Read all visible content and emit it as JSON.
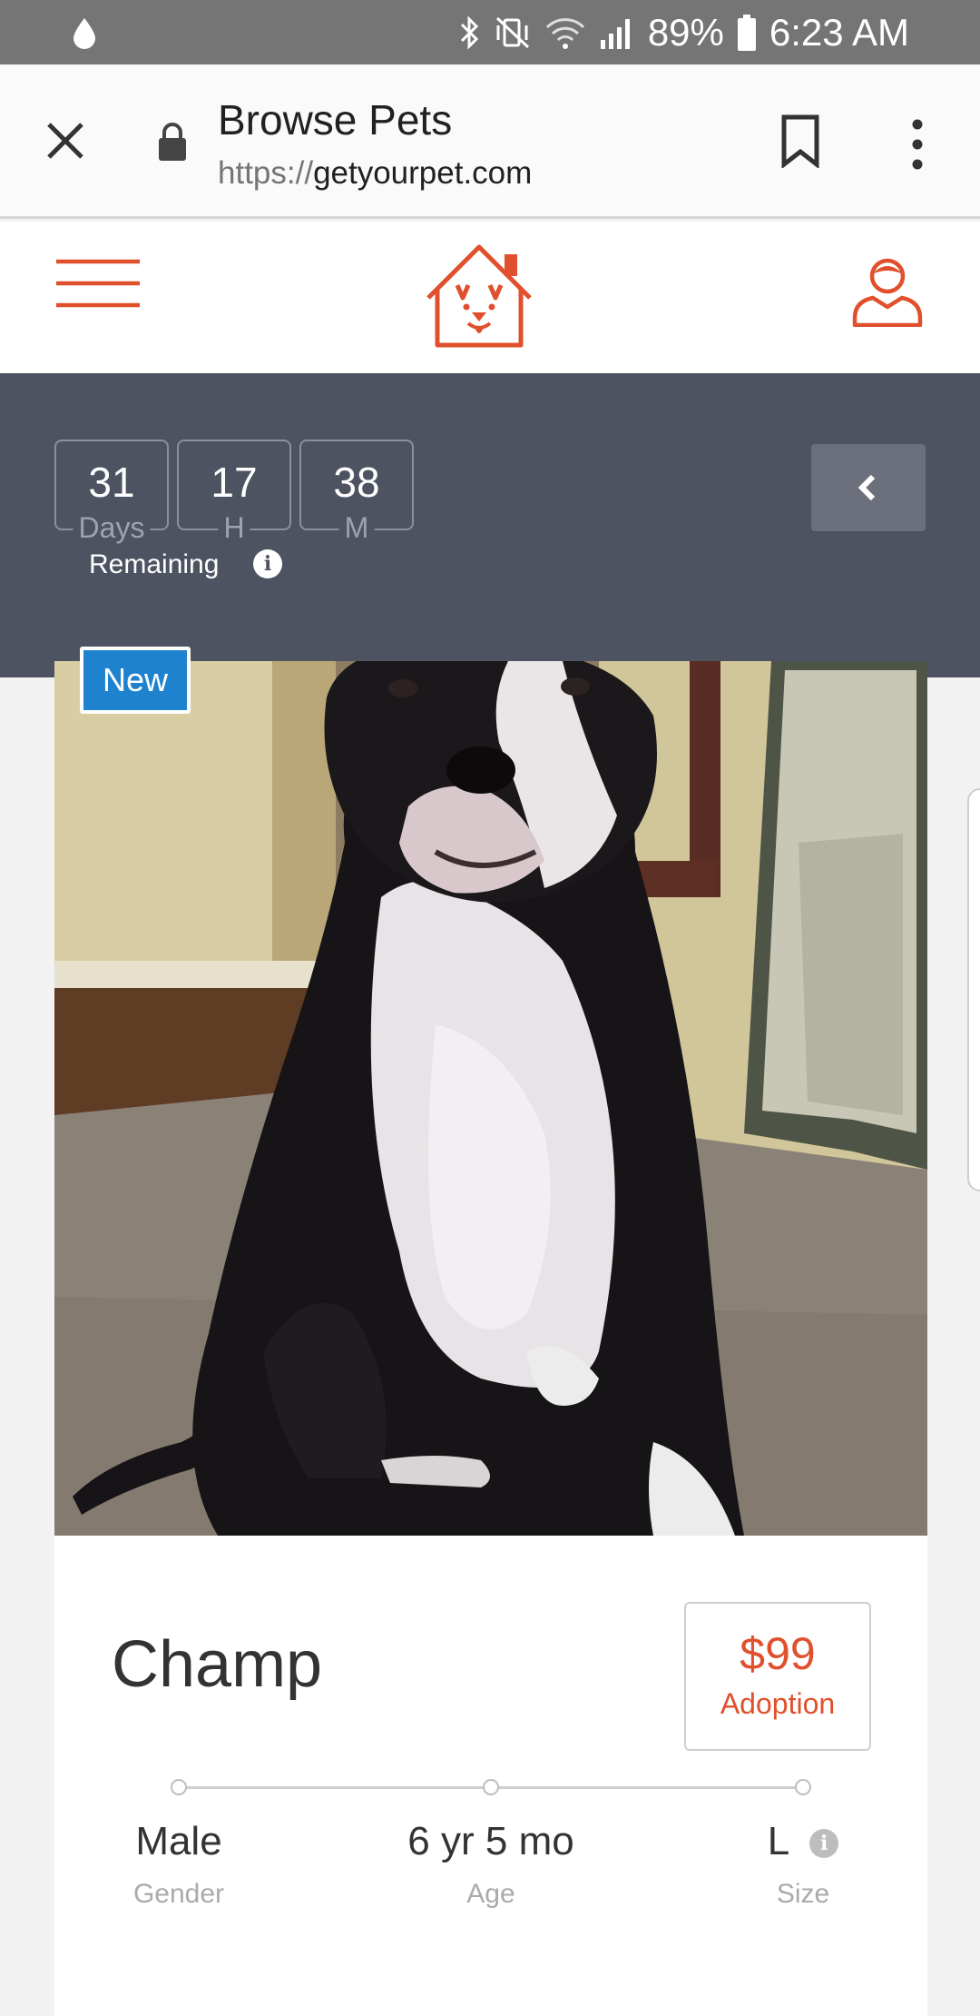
{
  "status_bar": {
    "battery": "89%",
    "time": "6:23 AM"
  },
  "browser": {
    "title": "Browse Pets",
    "url_scheme": "https://",
    "url_host": "getyourpet.com"
  },
  "site": {
    "accent": "#e0502c"
  },
  "countdown": {
    "days": "31",
    "days_label": "Days",
    "hours": "17",
    "hours_label": "H",
    "minutes": "38",
    "minutes_label": "M",
    "remaining_label": "Remaining",
    "panel_color": "#4d5361"
  },
  "pet": {
    "badge": "New",
    "badge_color": "#1f82cf",
    "name": "Champ",
    "price": "$99",
    "price_label": "Adoption",
    "attributes": [
      {
        "value": "Male",
        "label": "Gender"
      },
      {
        "value": "6 yr 5 mo",
        "label": "Age"
      },
      {
        "value": "L",
        "label": "Size"
      }
    ]
  }
}
